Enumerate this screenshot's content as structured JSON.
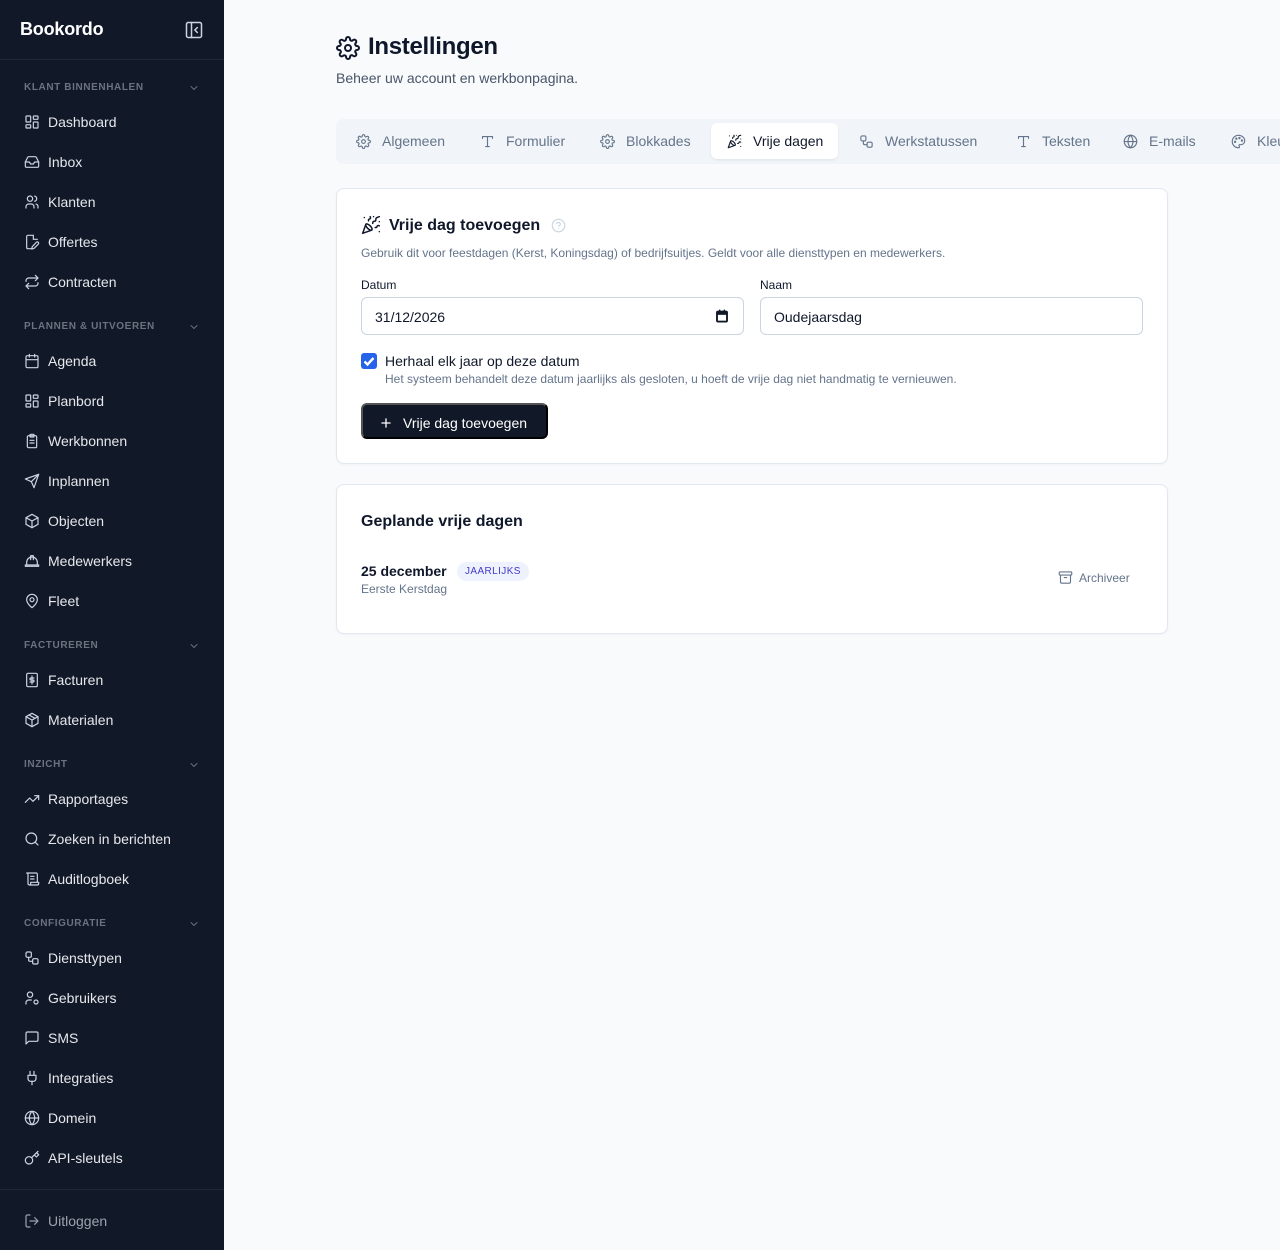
{
  "sidebar": {
    "brand": "Bookordo",
    "sections": [
      {
        "title": "KLANT BINNENHALEN",
        "items": [
          "Dashboard",
          "Inbox",
          "Klanten",
          "Offertes",
          "Contracten"
        ]
      },
      {
        "title": "PLANNEN & UITVOEREN",
        "items": [
          "Agenda",
          "Planbord",
          "Werkbonnen",
          "Inplannen",
          "Objecten",
          "Medewerkers",
          "Fleet"
        ]
      },
      {
        "title": "FACTUREREN",
        "items": [
          "Facturen",
          "Materialen"
        ]
      },
      {
        "title": "INZICHT",
        "items": [
          "Rapportages",
          "Zoeken in berichten",
          "Auditlogboek"
        ]
      },
      {
        "title": "CONFIGURATIE",
        "items": [
          "Diensttypen",
          "Gebruikers",
          "SMS",
          "Integraties",
          "Domein",
          "API-sleutels"
        ]
      }
    ],
    "logout": "Uitloggen"
  },
  "header": {
    "title": "Instellingen",
    "subtitle": "Beheer uw account en werkbonpagina."
  },
  "tabs": [
    "Algemeen",
    "Formulier",
    "Blokkades",
    "Vrije dagen",
    "Werkstatussen",
    "Teksten",
    "E-mails",
    "Kleuren"
  ],
  "active_tab": "Vrije dagen",
  "add_card": {
    "title": "Vrije dag toevoegen",
    "description": "Gebruik dit voor feestdagen (Kerst, Koningsdag) of bedrijfsuitjes. Geldt voor alle diensttypen en medewerkers.",
    "date_label": "Datum",
    "date_value": "31/12/2026",
    "name_label": "Naam",
    "name_value": "Oudejaarsdag",
    "repeat_label": "Herhaal elk jaar op deze datum",
    "repeat_checked": true,
    "repeat_help": "Het systeem behandelt deze datum jaarlijks als gesloten, u hoeft de vrije dag niet handmatig te vernieuwen.",
    "submit_label": "Vrije dag toevoegen"
  },
  "planned_card": {
    "title": "Geplande vrije dagen",
    "items": [
      {
        "date": "25 december",
        "badge": "JAARLIJKS",
        "name": "Eerste Kerstdag",
        "action": "Archiveer"
      }
    ]
  },
  "colors": {
    "sidebar_bg": "#111827",
    "accent": "#2563eb",
    "badge_bg": "#eef2ff",
    "badge_text": "#4338ca"
  }
}
